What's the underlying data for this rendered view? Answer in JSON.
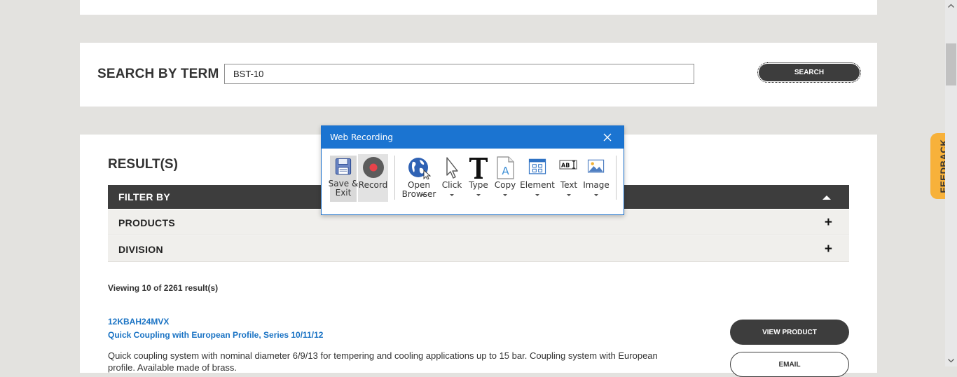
{
  "search": {
    "label": "SEARCH BY TERM",
    "value": "BST-10",
    "button": "SEARCH"
  },
  "results": {
    "title": "RESULT(S)",
    "filter_label": "FILTER BY",
    "facets": [
      {
        "label": "PRODUCTS",
        "toggle": "+"
      },
      {
        "label": "DIVISION",
        "toggle": "+"
      }
    ],
    "viewing": "Viewing 10 of 2261 result(s)",
    "items": [
      {
        "code": "12KBAH24MVX",
        "title": "Quick Coupling with European Profile, Series 10/11/12",
        "description": "Quick coupling system with nominal diameter 6/9/13 for tempering and cooling applications up to 15 bar. Coupling system with European profile. Available made of brass.",
        "view_button": "VIEW PRODUCT",
        "email_button": "EMAIL"
      }
    ]
  },
  "feedback_tab": "FEEDBACK",
  "recorder": {
    "title": "Web Recording",
    "tools": [
      {
        "icon": "save-icon",
        "label": "Save & Exit"
      },
      {
        "icon": "record-icon",
        "label": "Record"
      },
      {
        "icon": "globe-icon",
        "label": "Open Browser"
      },
      {
        "icon": "cursor-icon",
        "label": "Click"
      },
      {
        "icon": "type-icon",
        "label": "Type"
      },
      {
        "icon": "copy-icon",
        "label": "Copy"
      },
      {
        "icon": "element-icon",
        "label": "Element"
      },
      {
        "icon": "text-icon",
        "label": "Text"
      },
      {
        "icon": "image-icon",
        "label": "Image"
      }
    ]
  },
  "colors": {
    "accent": "#1b74d1",
    "link": "#1a73c4",
    "dark_button": "#3d3d3d",
    "feedback": "#f7b13a",
    "record": "#e8434a"
  }
}
